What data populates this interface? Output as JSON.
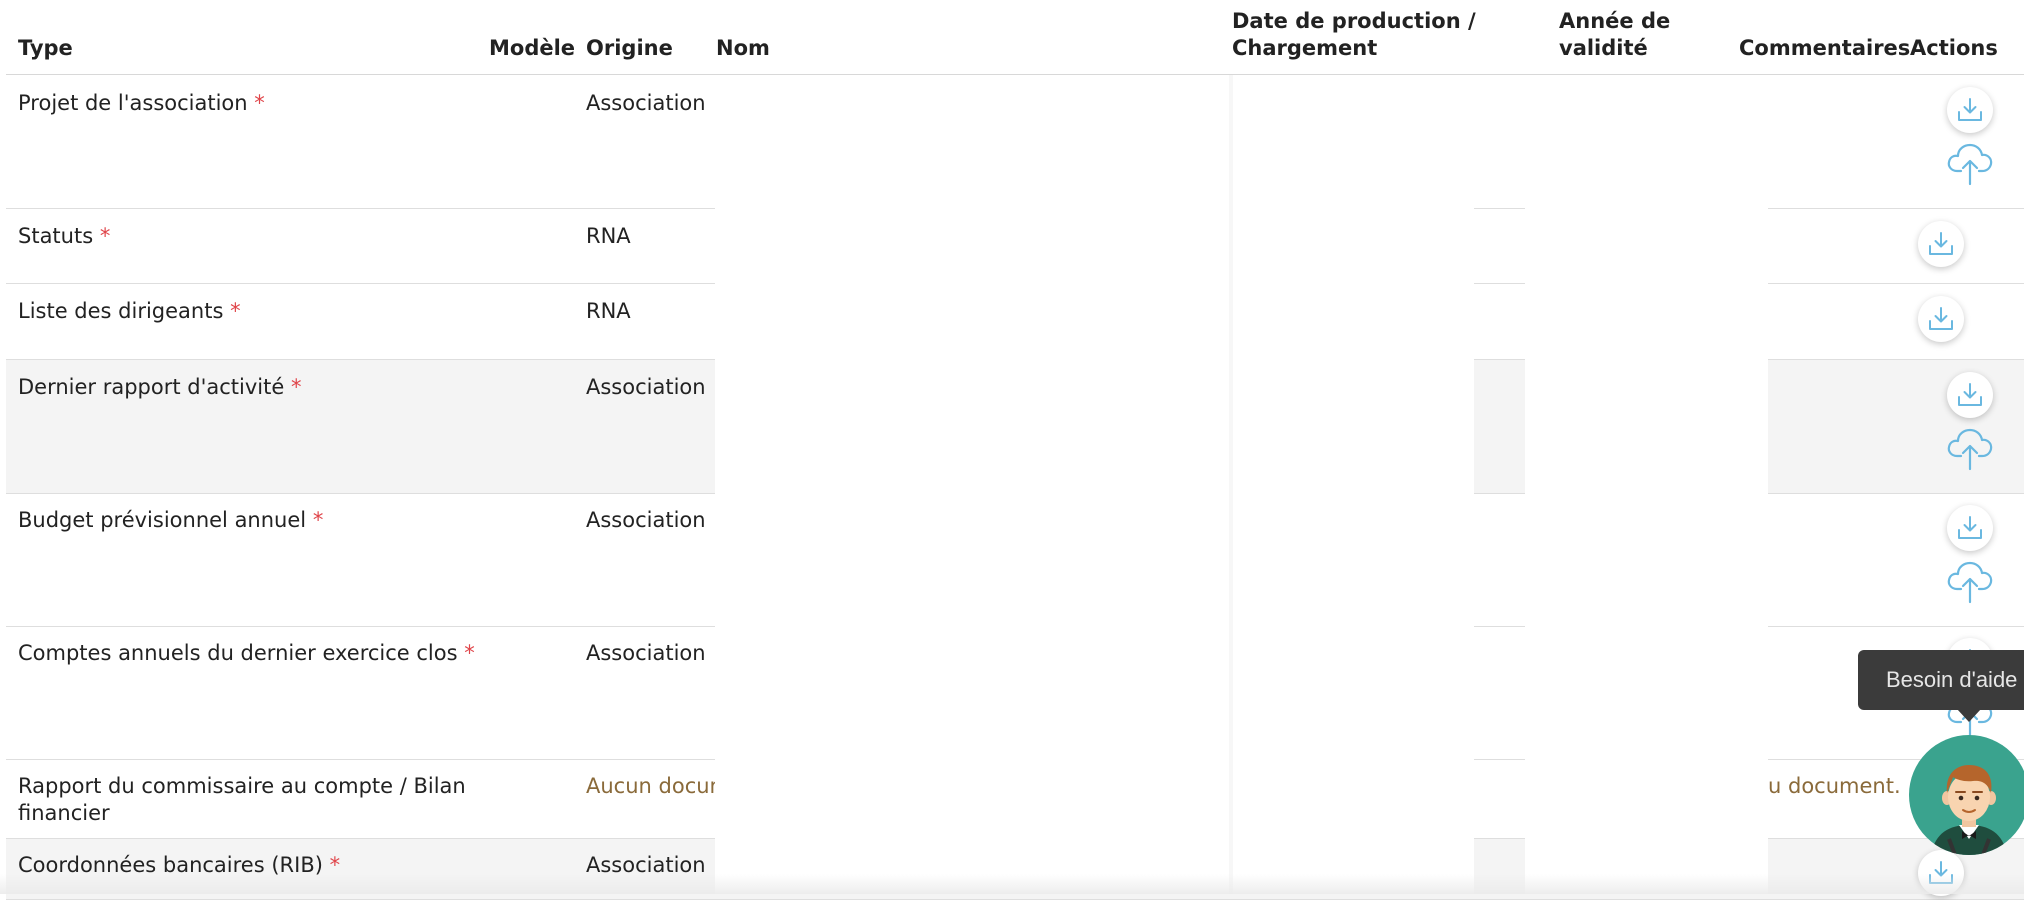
{
  "header": {
    "type": "Type",
    "modele": "Modèle",
    "origine": "Origine",
    "nom": "Nom",
    "date_line1": "Date de production /",
    "date_line2": "Chargement",
    "annee_line1": "Année de",
    "annee_line2": "validité",
    "commentaires": "Commentaires",
    "actions": "Actions"
  },
  "rows": [
    {
      "type": "Projet de l'association",
      "required": "*",
      "origin": "Association"
    },
    {
      "type": "Statuts",
      "required": "*",
      "origin": "RNA"
    },
    {
      "type": "Liste des dirigeants",
      "required": "*",
      "origin": "RNA"
    },
    {
      "type": "Dernier rapport d'activité",
      "required": "*",
      "origin": "Association"
    },
    {
      "type": "Budget prévisionnel annuel",
      "required": "*",
      "origin": "Association"
    },
    {
      "type": "Comptes annuels du dernier exercice clos",
      "required": "*",
      "origin": "Association"
    },
    {
      "type_line1": "Rapport du commissaire au compte / Bilan",
      "type_line2": "financier",
      "origin": "Aucun docum",
      "comment": "u document."
    },
    {
      "type": "Coordonnées bancaires (RIB)",
      "required": "*",
      "origin": "Association"
    }
  ],
  "help": {
    "tooltip": "Besoin d'aide"
  },
  "icons": {
    "download": "download-icon",
    "upload": "cloud-upload-icon",
    "assistant": "assistant-avatar-icon"
  },
  "colors": {
    "icon_blue": "#6ab8e0",
    "required_red": "#e0454a",
    "no_document_brown": "#8a6a3a",
    "avatar_green": "#3aa38e"
  }
}
